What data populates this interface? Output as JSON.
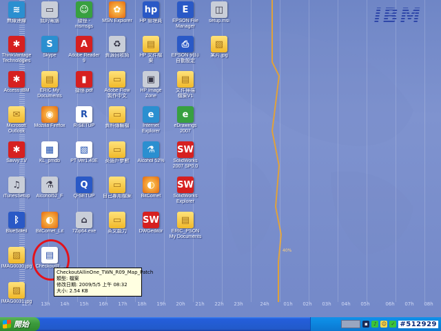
{
  "desktop": {
    "top_row": [
      {
        "name": "wireless-connection-icon",
        "label": "無線連線"
      },
      {
        "name": "my-computer-icon",
        "label": "我的電腦"
      },
      {
        "name": "my-network-places-icon",
        "label": "捷徑 -\nmsmsgs"
      },
      {
        "name": "msn-explorer-icon",
        "label": "MSN Explorer"
      },
      {
        "name": "hp-manager-icon",
        "label": "HP 管理員"
      },
      {
        "name": "epson-file-manager-icon",
        "label": "EPSON File\nManager"
      },
      {
        "name": "setup-msi-icon",
        "label": "setup.msi"
      }
    ],
    "grid": [
      {
        "name": "thinkvantage-icon",
        "label": "ThinkVantage\nTechnologies"
      },
      {
        "name": "skype-icon",
        "label": "Skype"
      },
      {
        "name": "adobe-reader-icon",
        "label": "Adobe Reader\n9"
      },
      {
        "name": "recycle-bin-icon",
        "label": "資源回收筒"
      },
      {
        "name": "hp-folder-icon",
        "label": "HP 文件檔\n案"
      },
      {
        "name": "epson-scan-icon",
        "label": "EPSON 列印\n自動設定"
      },
      {
        "name": "jpg-file-icon",
        "label": "某片.jpg"
      },
      {
        "name": "access-ibm-icon",
        "label": "Access IBM"
      },
      {
        "name": "eric-documents-icon",
        "label": "ERIC My\nDocuments"
      },
      {
        "name": "pdf-file-icon",
        "label": "捷徑.pdf"
      },
      {
        "name": "adobe-flow-icon",
        "label": "Adobe Flow\n製作中文"
      },
      {
        "name": "hp-image-zone-icon",
        "label": "HP Image\nZone"
      },
      {
        "name": "scan-folder-icon",
        "label": "文件掃描\n檔案V1"
      },
      {
        "name": "outlook-icon",
        "label": "Microsoft\nOutlook"
      },
      {
        "name": "firefox-icon",
        "label": "Mozilla Firefox"
      },
      {
        "name": "r-setup-icon",
        "label": "R-SETUP"
      },
      {
        "name": "data-folder-icon",
        "label": "資料傳輸檔"
      },
      {
        "name": "internet-explorer-icon",
        "label": "Internet\nExplorer"
      },
      {
        "name": "edrawings-icon",
        "label": "eDrawings\n2007"
      },
      {
        "name": "savvy-tv-icon",
        "label": "Savvy TV"
      },
      {
        "name": "kl-pmdb-icon",
        "label": "KL_pmdb"
      },
      {
        "name": "pt-ver-icon",
        "label": "PT Ver1.40E"
      },
      {
        "name": "reference-folder-icon",
        "label": "英語戶參數"
      },
      {
        "name": "alcohol-icon",
        "label": "Alcohol 52%"
      },
      {
        "name": "solidworks-icon",
        "label": "SolidWorks\n2007 SP0.0"
      },
      {
        "name": "itunes-setup-icon",
        "label": "iTunesSetup"
      },
      {
        "name": "alcohol-f-icon",
        "label": "Alcohol52_F"
      },
      {
        "name": "q-setup-icon",
        "label": "Q-SETUP"
      },
      {
        "name": "personal-folder-icon",
        "label": "自己專用檔案"
      },
      {
        "name": "bitcomet-icon",
        "label": "BitComet"
      },
      {
        "name": "solidworks-explorer-icon",
        "label": "SolidWorks\nExplorer"
      },
      {
        "name": "bluesoleil-icon",
        "label": "BlueSoleil"
      },
      {
        "name": "bitcomet-lnk-icon",
        "label": "BitComet_Lit"
      },
      {
        "name": "7zip-icon",
        "label": "7Zip64.exe"
      },
      {
        "name": "english-folder-icon",
        "label": "英文能力"
      },
      {
        "name": "dwgeditor-icon",
        "label": "DWGeditor"
      },
      {
        "name": "eric-documents-2-icon",
        "label": "ERIC_PSON\nMy Documents"
      },
      {
        "name": "image-0030-icon",
        "label": "IMAG0030.jpg"
      },
      {
        "name": "checkout-file-icon",
        "label": "CheckoutR..."
      },
      {
        "name": "image-0031-icon",
        "label": "IMAG0031.jpg"
      }
    ]
  },
  "tooltip": {
    "line1": "CheckoutAllinOne_TWN_R09_Map_Patch",
    "line2": "類型: 檔案",
    "line3": "修改日期: 2009/5/5 上午 08:32",
    "line4": "大小: 2.54 KB"
  },
  "map": {
    "brand": "IBM",
    "hours": [
      "12h",
      "13h",
      "14h",
      "15h",
      "16h",
      "17h",
      "18h",
      "19h",
      "20h",
      "21h",
      "22h",
      "23h",
      "24h",
      "01h",
      "02h",
      "03h",
      "04h",
      "05h",
      "06h",
      "07h",
      "08h"
    ]
  },
  "taskbar": {
    "start_label": "開始",
    "clock": "#512929"
  }
}
